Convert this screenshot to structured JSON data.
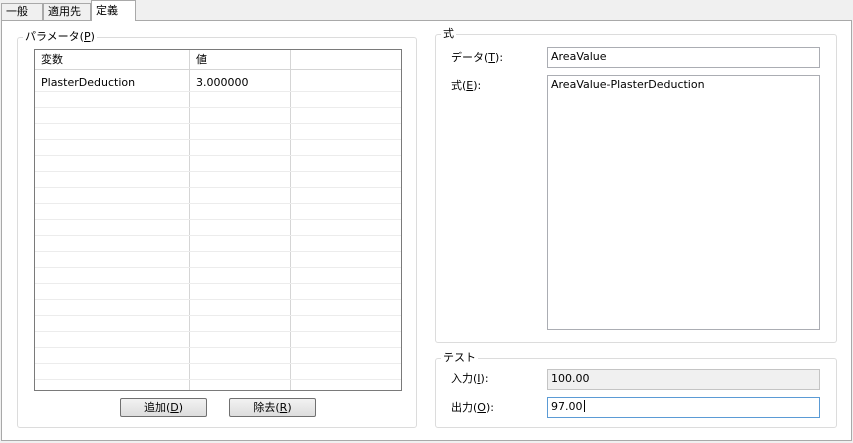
{
  "tabs": [
    {
      "label": "一般"
    },
    {
      "label": "適用先"
    },
    {
      "label": "定義"
    }
  ],
  "parameters": {
    "group_label_pre": "パラメータ(",
    "group_label_key": "P",
    "group_label_post": ")",
    "columns": [
      "変数",
      "値",
      ""
    ],
    "rows": [
      {
        "variable": "PlasterDeduction",
        "value": "3.000000"
      }
    ],
    "add_button": {
      "pre": "追加(",
      "key": "D",
      "post": ")"
    },
    "remove_button": {
      "pre": "除去(",
      "key": "R",
      "post": ")"
    }
  },
  "formula": {
    "group_label": "式",
    "data_label": {
      "pre": "データ(",
      "key": "T",
      "post": "):"
    },
    "data_value": "AreaValue",
    "expr_label": {
      "pre": "式(",
      "key": "E",
      "post": "):"
    },
    "expr_value": "AreaValue-PlasterDeduction"
  },
  "test": {
    "group_label": "テスト",
    "input_label": {
      "pre": "入力(",
      "key": "I",
      "post": "):"
    },
    "input_value": "100.00",
    "output_label": {
      "pre": "出力(",
      "key": "O",
      "post": "):"
    },
    "output_value": "97.00"
  }
}
